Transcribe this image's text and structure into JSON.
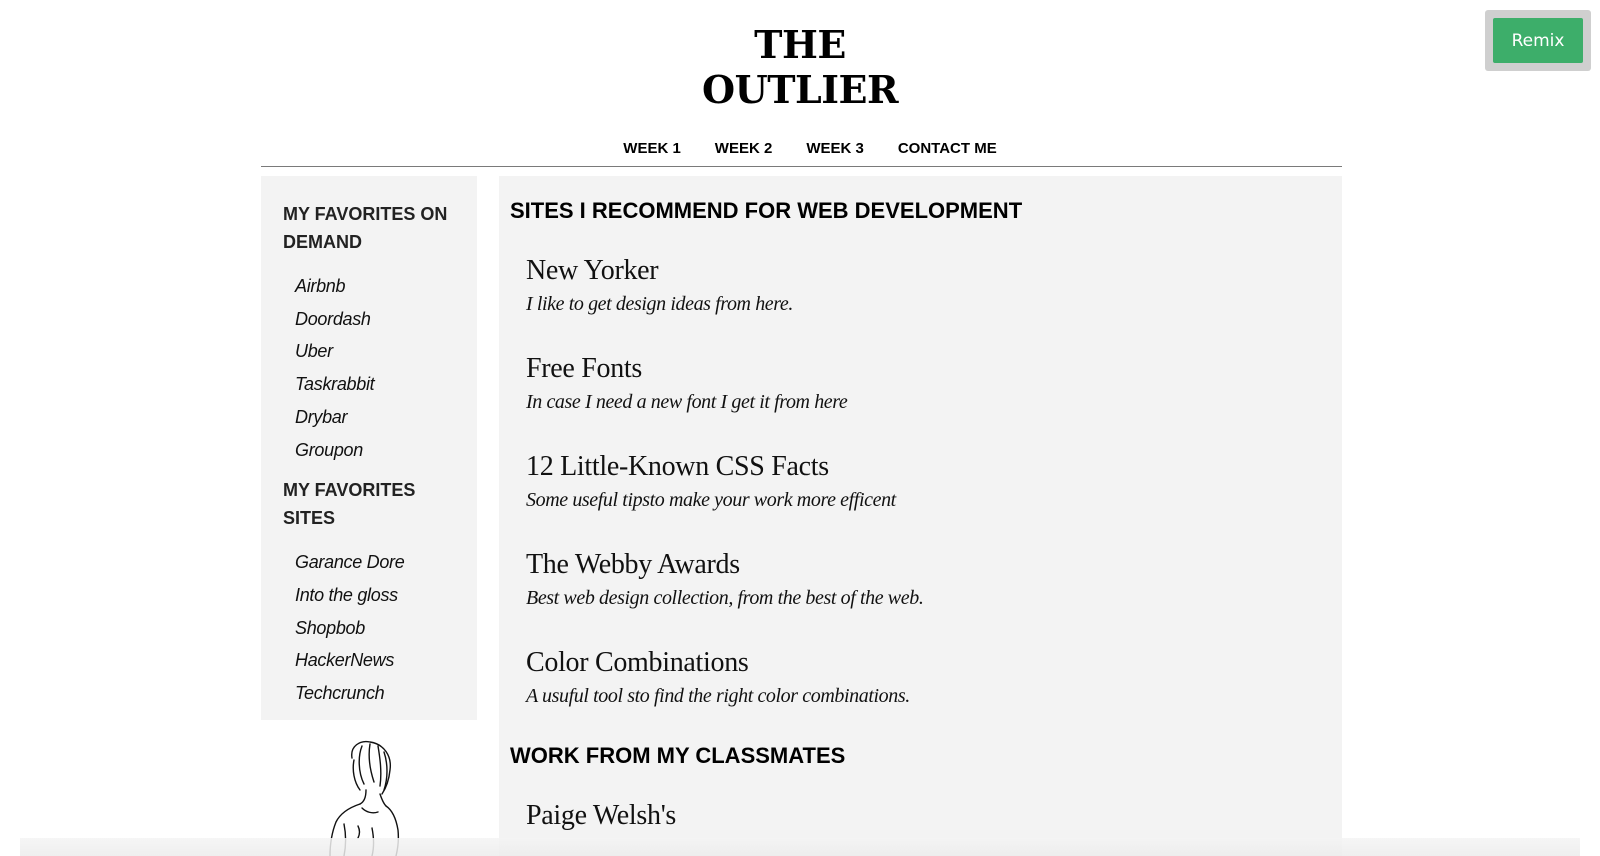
{
  "remix_label": "Remix",
  "site_title": {
    "line1": "THE",
    "line2": "OUTLIER"
  },
  "nav": [
    "WEEK 1",
    "WEEK 2",
    "WEEK 3",
    "CONTACT ME"
  ],
  "sidebar": {
    "sections": [
      {
        "heading": "MY FAVORITES ON DEMAND",
        "items": [
          "Airbnb",
          "Doordash",
          "Uber",
          "Taskrabbit",
          "Drybar",
          "Groupon"
        ]
      },
      {
        "heading": "MY FAVORITES SITES",
        "items": [
          "Garance Dore",
          "Into the gloss",
          "Shopbob",
          "HackerNews",
          "Techcrunch"
        ]
      }
    ]
  },
  "main": {
    "section1_heading": "SITES I RECOMMEND FOR WEB DEVELOPMENT",
    "entries": [
      {
        "title": "New Yorker",
        "desc": "I like to get design ideas from here."
      },
      {
        "title": "Free Fonts",
        "desc": "In case I need a new font I get it from here"
      },
      {
        "title": "12 Little-Known CSS Facts",
        "desc": "Some useful tipsto make your work more efficent"
      },
      {
        "title": "The Webby Awards",
        "desc": "Best web design collection, from the best of the web."
      },
      {
        "title": "Color Combinations",
        "desc": "A usuful tool sto find the right color combinations."
      }
    ],
    "section2_heading": "WORK FROM MY CLASSMATES",
    "classmates": [
      {
        "title": "Paige Welsh's"
      }
    ]
  }
}
